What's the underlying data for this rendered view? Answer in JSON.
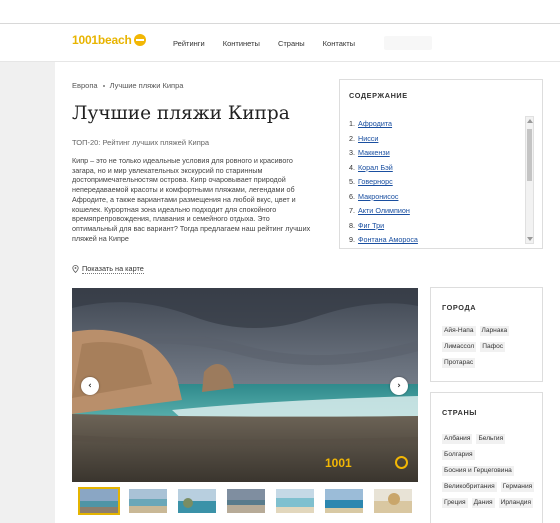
{
  "header": {
    "logo": "1001beach",
    "nav": [
      "Рейтинги",
      "Континеты",
      "Страны",
      "Контакты"
    ]
  },
  "breadcrumb": [
    "Европа",
    "Лучшие пляжи Кипра"
  ],
  "page_title": "Лучшие пляжи Кипра",
  "subtitle": "ТОП-20: Рейтинг лучших пляжей Кипра",
  "intro": "Кипр – это не только идеальные условия для ровного и красивого загара, но и мир увлекательных экскурсий по старинным достопримечательностям острова. Кипр очаровывает природой непередаваемой красоты и комфортными пляжами, легендами об Афродите, а также вариантами размещения на любой вкус, цвет и кошелек. Курортная зона идеально подходит для спокойного времяпрепровождения, плавания и семейного отдыха. Это оптимальный для вас вариант? Тогда предлагаем наш рейтинг лучших пляжей на Кипре",
  "map_link": "Показать на карте",
  "toc": {
    "title": "СОДЕРЖАНИЕ",
    "items": [
      {
        "num": "1.",
        "label": "Афродита"
      },
      {
        "num": "2.",
        "label": "Нисси"
      },
      {
        "num": "3.",
        "label": "Маккензи"
      },
      {
        "num": "4.",
        "label": "Корал Бэй"
      },
      {
        "num": "5.",
        "label": "Говернорс"
      },
      {
        "num": "6.",
        "label": "Макронисос"
      },
      {
        "num": "7.",
        "label": "Акти Олимпион"
      },
      {
        "num": "8.",
        "label": "Фиг Три"
      },
      {
        "num": "9.",
        "label": "Фонтана Амороса"
      }
    ]
  },
  "slider": {
    "prev": "‹",
    "next": "›",
    "logo": "1001"
  },
  "cities": {
    "title": "ГОРОДА",
    "items": [
      "Айя-Напа",
      "Ларнака",
      "Лимассол",
      "Пафос",
      "Протарас"
    ]
  },
  "countries": {
    "title": "СТРАНЫ",
    "items": [
      "Албания",
      "Бельгия",
      "Болгария",
      "Босния и Герцеговина",
      "Великобритания",
      "Германия",
      "Греция",
      "Дания",
      "Ирландия"
    ]
  },
  "colors": {
    "accent": "#e8b400",
    "link": "#1a4fa0"
  }
}
